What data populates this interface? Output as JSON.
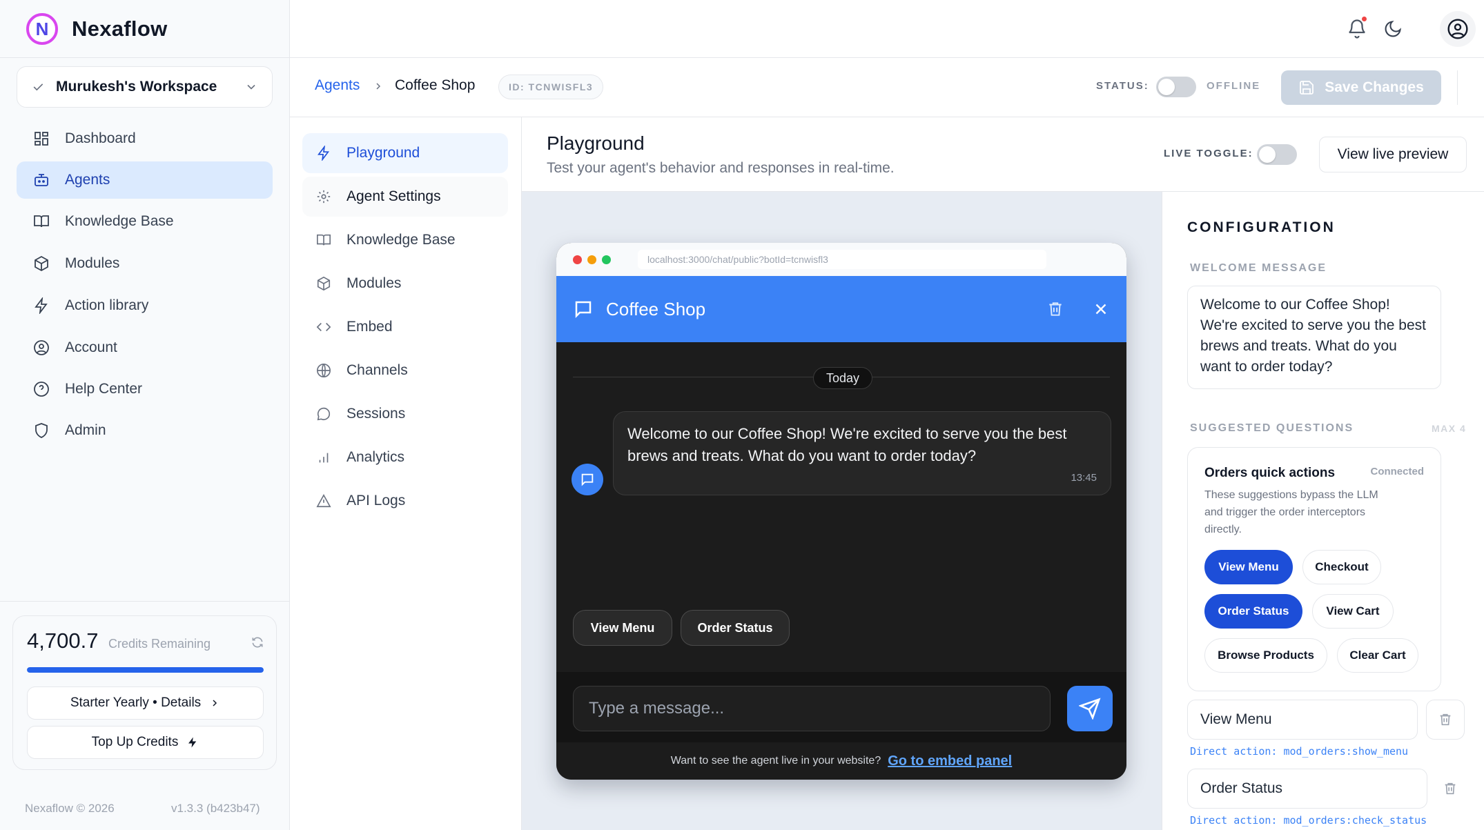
{
  "app": {
    "name": "Nexaflow",
    "logo_letter": "N"
  },
  "workspace": {
    "name": "Murukesh's Workspace"
  },
  "sidebar": {
    "items": [
      {
        "label": "Dashboard",
        "icon": "dashboard-icon"
      },
      {
        "label": "Agents",
        "icon": "bot-icon",
        "active": true
      },
      {
        "label": "Knowledge Base",
        "icon": "book-icon"
      },
      {
        "label": "Modules",
        "icon": "cube-icon"
      },
      {
        "label": "Action library",
        "icon": "bolt-icon"
      },
      {
        "label": "Account",
        "icon": "user-circle-icon"
      },
      {
        "label": "Help Center",
        "icon": "help-icon"
      },
      {
        "label": "Admin",
        "icon": "shield-icon"
      }
    ]
  },
  "credits": {
    "amount": "4,700.7",
    "label": "Credits Remaining",
    "fill_percent": 100,
    "plan_label": "Starter Yearly • Details",
    "topup_label": "Top Up Credits"
  },
  "footer": {
    "copyright": "Nexaflow © 2026",
    "version": "v1.3.3 (b423b47)"
  },
  "header": {
    "breadcrumb_root": "Agents",
    "breadcrumb_current": "Coffee Shop",
    "agent_id": "ID: TCNWISFL3",
    "status_label": "STATUS:",
    "status_value": "OFFLINE",
    "save_label": "Save Changes"
  },
  "subnav": {
    "items": [
      {
        "label": "Playground",
        "icon": "bolt-icon"
      },
      {
        "label": "Agent Settings",
        "icon": "gear-icon"
      },
      {
        "label": "Knowledge Base",
        "icon": "book-icon"
      },
      {
        "label": "Modules",
        "icon": "cube-icon"
      },
      {
        "label": "Embed",
        "icon": "code-icon"
      },
      {
        "label": "Channels",
        "icon": "globe-icon"
      },
      {
        "label": "Sessions",
        "icon": "chat-icon"
      },
      {
        "label": "Analytics",
        "icon": "bar-chart-icon"
      },
      {
        "label": "API Logs",
        "icon": "warning-icon"
      }
    ]
  },
  "page": {
    "title": "Playground",
    "subtitle": "Test your agent's behavior and responses in real-time.",
    "live_toggle_label": "LIVE TOGGLE:",
    "live_preview_label": "View live preview"
  },
  "preview": {
    "url": "localhost:3000/chat/public?botId=tcnwisfl3",
    "title": "Coffee Shop",
    "date_divider": "Today",
    "message": "Welcome to our Coffee Shop! We're excited to serve you the best brews and treats. What do you want to order today?",
    "message_time": "13:45",
    "chips": [
      "View Menu",
      "Order Status"
    ],
    "input_placeholder": "Type a message...",
    "footer_text": "Want to see the agent live in your website?",
    "footer_link": "Go to embed panel",
    "colors": {
      "header": "#3b82f6",
      "body": "#1c1c1c"
    }
  },
  "config": {
    "heading": "CONFIGURATION",
    "welcome_label": "WELCOME MESSAGE",
    "welcome_text": "Welcome to our Coffee Shop! We're excited to serve you the best brews and treats. What do you want to order today?",
    "suggested_label": "SUGGESTED QUESTIONS",
    "suggested_max": "MAX 4",
    "quick_actions": {
      "title": "Orders quick actions",
      "status": "Connected",
      "description": "These suggestions bypass the LLM and trigger the order interceptors directly.",
      "pills": [
        "View Menu",
        "Checkout",
        "Order Status",
        "View Cart",
        "Browse Products",
        "Clear Cart"
      ]
    },
    "questions": [
      {
        "value": "View Menu",
        "action": "Direct action: mod_orders:show_menu"
      },
      {
        "value": "Order Status",
        "action": "Direct action: mod_orders:check_status"
      }
    ]
  }
}
